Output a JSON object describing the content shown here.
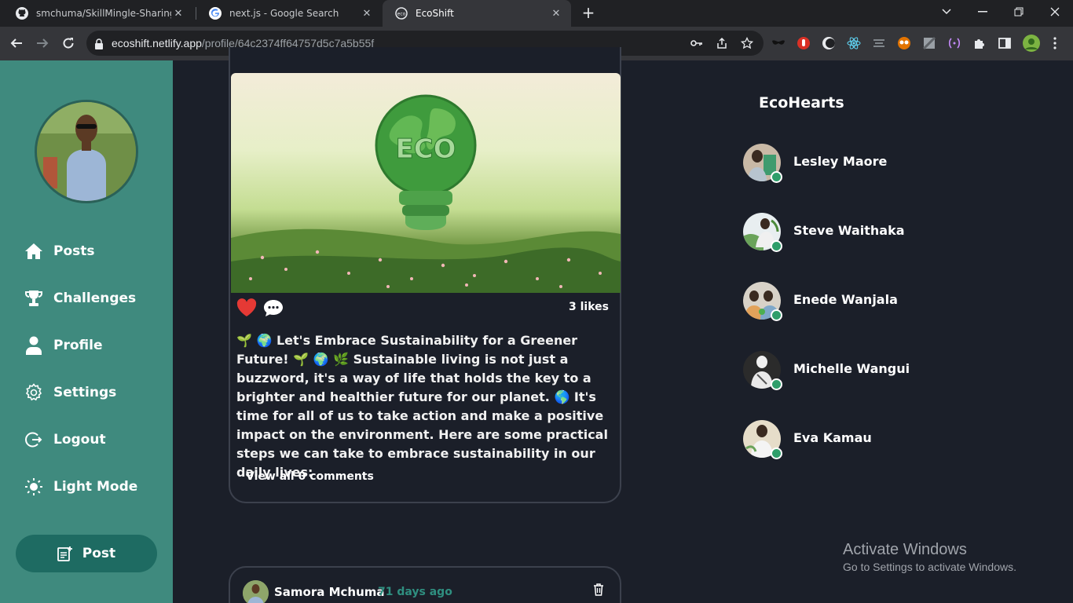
{
  "browser": {
    "tabs": [
      {
        "label": "smchuma/SkillMingle-Sharing-S",
        "icon": "github-icon",
        "active": false
      },
      {
        "label": "next.js - Google Search",
        "icon": "google-icon",
        "active": false
      },
      {
        "label": "EcoShift",
        "icon": "ecoshift-icon",
        "active": true
      }
    ],
    "url_host": "ecoshift.netlify.app",
    "url_path": "/profile/64c2374ff64757d5c7a5b55f"
  },
  "sidebar": {
    "nav": [
      {
        "label": "Posts",
        "icon": "home-icon"
      },
      {
        "label": "Challenges",
        "icon": "trophy-icon"
      },
      {
        "label": "Profile",
        "icon": "user-icon"
      },
      {
        "label": "Settings",
        "icon": "gear-icon"
      },
      {
        "label": "Logout",
        "icon": "logout-icon"
      },
      {
        "label": "Light Mode",
        "icon": "sun-icon"
      }
    ],
    "post_button": "Post"
  },
  "feed": {
    "post1": {
      "likes": "3 likes",
      "text": "🌱 🌍 Let's Embrace Sustainability for a Greener Future! 🌱 🌍 🌿 Sustainable living is not just a buzzword, it's a way of life that holds the key to a brighter and healthier future for our planet. 🌎 It's time for all of us to take action and make a positive impact on the environment. Here are some practical steps we can take to embrace sustainability in our daily lives:",
      "view_comments": "View all 0 comments",
      "image_text": "ECO"
    },
    "post2": {
      "author": "Samora Mchuma",
      "ago": "71 days ago"
    }
  },
  "ecohearts": {
    "title": "EcoHearts",
    "friends": [
      {
        "name": "Lesley Maore"
      },
      {
        "name": "Steve Waithaka"
      },
      {
        "name": "Enede Wanjala"
      },
      {
        "name": "Michelle Wangui"
      },
      {
        "name": "Eva Kamau"
      }
    ]
  },
  "watermark": {
    "line1": "Activate Windows",
    "line2": "Go to Settings to activate Windows."
  },
  "colors": {
    "sidebar": "#3f8a7e",
    "page_bg": "#1b1f29",
    "accent": "#1e6b62",
    "online": "#2e9e6a",
    "like": "#e53935"
  }
}
